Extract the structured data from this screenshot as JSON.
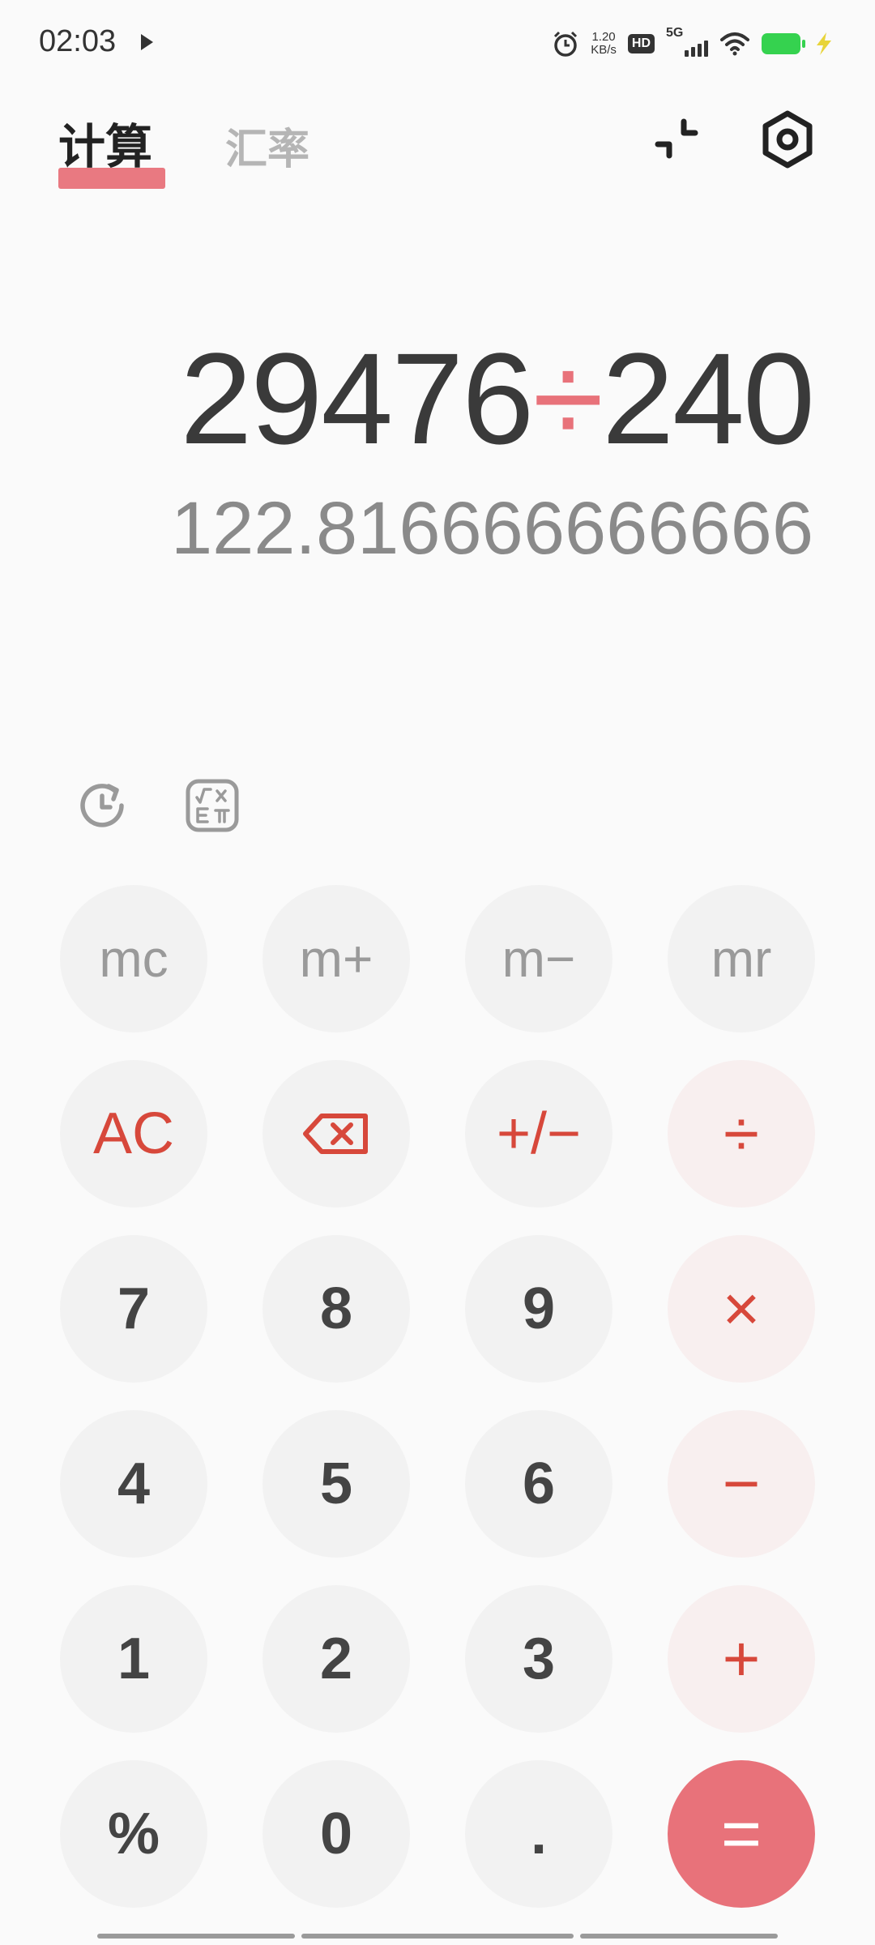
{
  "status_bar": {
    "time": "02:03",
    "net_speed_value": "1.20",
    "net_speed_unit": "KB/s",
    "hd_label": "HD",
    "network_label": "5G",
    "battery_color": "#35d24f"
  },
  "header": {
    "tabs": [
      {
        "label": "计算",
        "active": true
      },
      {
        "label": "汇率",
        "active": false
      }
    ],
    "accent_color": "#e8727a"
  },
  "display": {
    "operand1": "29476",
    "operator": "÷",
    "operand2": "240",
    "result": "122.816666666666"
  },
  "keypad": {
    "rows": [
      [
        "mc",
        "m+",
        "m−",
        "mr"
      ],
      [
        "AC",
        "⌫",
        "+/−",
        "÷"
      ],
      [
        "7",
        "8",
        "9",
        "×"
      ],
      [
        "4",
        "5",
        "6",
        "−"
      ],
      [
        "1",
        "2",
        "3",
        "+"
      ],
      [
        "%",
        "0",
        ".",
        "="
      ]
    ]
  },
  "icons": {
    "header_right": [
      "collapse-icon",
      "settings-icon"
    ],
    "tools": [
      "history-icon",
      "scientific-mode-icon"
    ],
    "backspace": "backspace-icon"
  }
}
